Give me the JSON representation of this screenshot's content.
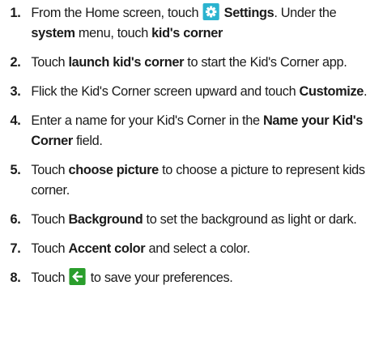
{
  "steps": [
    {
      "number": "1.",
      "t1": "From the Home screen, touch",
      "icon": "settings-gear-icon",
      "b1": "Settings",
      "t2": ". Under the",
      "b2": "system",
      "t3": " menu, touch ",
      "b3": "kid's corner"
    },
    {
      "number": "2.",
      "t1": "Touch ",
      "b1": "launch kid's corner",
      "t2": " to start the Kid's Corner app."
    },
    {
      "number": "3.",
      "t1": "Flick the Kid's Corner screen upward and touch ",
      "b1": "Customize",
      "t2": "."
    },
    {
      "number": "4.",
      "t1": "Enter a name for your Kid's Corner in the ",
      "b1": "Name your Kid's Corner",
      "t2": " field."
    },
    {
      "number": "5.",
      "t1": "Touch ",
      "b1": "choose picture",
      "t2": " to choose a picture to represent kids corner."
    },
    {
      "number": "6.",
      "t1": "Touch ",
      "b1": "Background",
      "t2": " to set the background as light or dark."
    },
    {
      "number": "7.",
      "t1": "Touch ",
      "b1": "Accent color",
      "t2": " and select a color."
    },
    {
      "number": "8.",
      "t1": "Touch",
      "icon": "back-arrow-icon",
      "t2": "to save your preferences."
    }
  ],
  "colors": {
    "settings_icon_bg": "#2bb3cf",
    "back_icon_bg": "#2a9e2c"
  }
}
